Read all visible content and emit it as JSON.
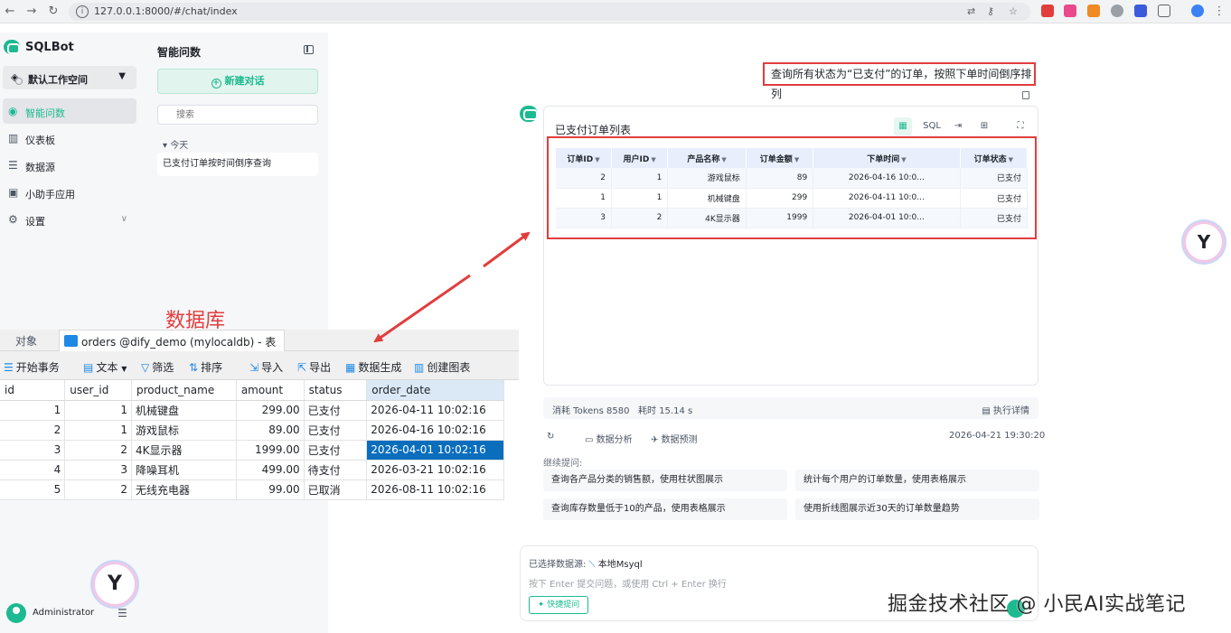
{
  "browser": {
    "url": "127.0.0.1:8000/#/chat/index",
    "ext_colors": [
      "#e23d3d",
      "#e84a8a",
      "#f08a24",
      "#9aa0a6",
      "#3b5bdb",
      "#5f6368",
      "#3b82f6"
    ]
  },
  "sidebar": {
    "brand": "SQLBot",
    "workspace": "默认工作空间",
    "items": [
      {
        "label": "智能问数",
        "icon": "chat-icon",
        "active": true
      },
      {
        "label": "仪表板",
        "icon": "dashboard-icon"
      },
      {
        "label": "数据源",
        "icon": "database-icon"
      },
      {
        "label": "小助手应用",
        "icon": "assistant-icon"
      },
      {
        "label": "设置",
        "icon": "gear-icon"
      }
    ],
    "user": "Administrator"
  },
  "history": {
    "title": "智能问数",
    "new_chat": "新建对话",
    "search_placeholder": "搜索",
    "group": "今天",
    "items": [
      "已支付订单按时间倒序查询"
    ]
  },
  "chat": {
    "question": "查询所有状态为“已支付”的订单，按照下单时间倒序排列",
    "result": {
      "title": "已支付订单列表",
      "columns": [
        "订单ID",
        "用户ID",
        "产品名称",
        "订单金额",
        "下单时间",
        "订单状态"
      ],
      "rows": [
        [
          "2",
          "1",
          "游戏鼠标",
          "89",
          "2026-04-16 10:0...",
          "已支付"
        ],
        [
          "1",
          "1",
          "机械键盘",
          "299",
          "2026-04-11 10:0...",
          "已支付"
        ],
        [
          "3",
          "2",
          "4K显示器",
          "1999",
          "2026-04-01 10:0...",
          "已支付"
        ]
      ]
    },
    "tokens": "消耗 Tokens 8580",
    "elapsed": "耗时 15.14 s",
    "detail": "执行详情",
    "analyze": "数据分析",
    "predict": "数据预测",
    "timestamp": "2026-04-21 19:30:20",
    "continue_label": "继续提问:",
    "suggestions": [
      "查询各产品分类的销售额，使用柱状图展示",
      "统计每个用户的订单数量，使用表格展示",
      "查询库存数量低于10的产品，使用表格展示",
      "使用折线图展示近30天的订单数量趋势"
    ],
    "input": {
      "datasource_label": "已选择数据源:",
      "datasource": "本地Msyql",
      "placeholder": "按下 Enter 提交问题，或使用 Ctrl + Enter 换行",
      "quick": "快捷提问"
    }
  },
  "watermark": "掘金技术社区 @ 小民AI实战笔记",
  "db_label": "数据库",
  "db": {
    "tab_objects": "对象",
    "tab_table": "orders @dify_demo (mylocaldb) - 表",
    "toolbar": [
      "开始事务",
      "文本",
      "筛选",
      "排序",
      "导入",
      "导出",
      "数据生成",
      "创建图表"
    ],
    "columns": [
      "id",
      "user_id",
      "product_name",
      "amount",
      "status",
      "order_date"
    ],
    "rows": [
      [
        "1",
        "1",
        "机械键盘",
        "299.00",
        "已支付",
        "2026-04-11 10:02:16"
      ],
      [
        "2",
        "1",
        "游戏鼠标",
        "89.00",
        "已支付",
        "2026-04-16 10:02:16"
      ],
      [
        "3",
        "2",
        "4K显示器",
        "1999.00",
        "已支付",
        "2026-04-01 10:02:16"
      ],
      [
        "4",
        "3",
        "降噪耳机",
        "499.00",
        "待支付",
        "2026-03-21 10:02:16"
      ],
      [
        "5",
        "2",
        "无线充电器",
        "99.00",
        "已取消",
        "2026-08-11 10:02:16"
      ]
    ]
  },
  "colors": {
    "accent": "#1cba90",
    "annotation": "#e23d3d",
    "selection": "#0a6ebd"
  }
}
